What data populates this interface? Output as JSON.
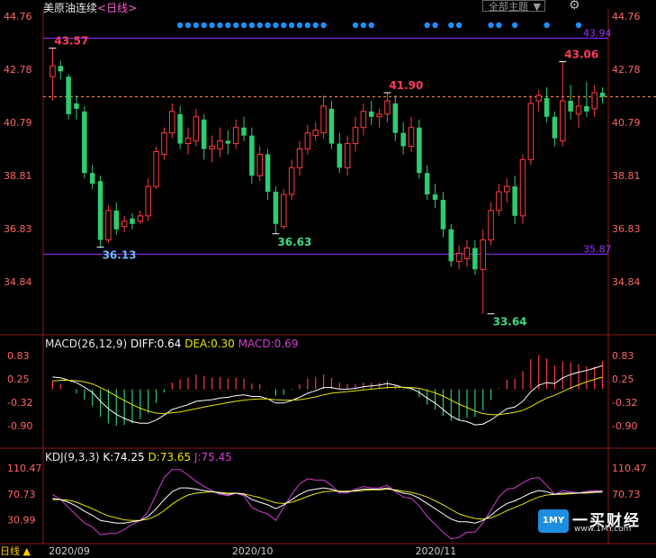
{
  "header": {
    "title": "美原油连续",
    "period_tag": "<日线>",
    "theme_label": "全部主题",
    "theme_caret": "▼",
    "settings_icon": "gear-icon"
  },
  "colors": {
    "up": "#ff3b3b",
    "down": "#2ecc71",
    "purple_line": "#9b30ff",
    "dashed": "#ff8c42",
    "diff": "#ffffff",
    "dea": "#e6e600",
    "macd_label": "#d040d0",
    "marker_dot": "#1e90ff"
  },
  "price_axis": {
    "left_labels": [
      "44.76",
      "42.78",
      "40.79",
      "38.81",
      "36.83",
      "34.84"
    ],
    "right_labels": [
      "44.76",
      "42.78",
      "40.79",
      "38.81",
      "36.83",
      "34.84"
    ]
  },
  "horizontal_lines": {
    "upper": {
      "value": 43.94,
      "label": "43.94"
    },
    "lower": {
      "value": 35.87,
      "label": "35.87"
    },
    "last_price": {
      "value": 41.75
    }
  },
  "annotations": [
    {
      "label": "43.57",
      "value": 43.57,
      "index": 0,
      "kind": "high"
    },
    {
      "label": "36.13",
      "value": 36.13,
      "index": 6,
      "kind": "low"
    },
    {
      "label": "36.63",
      "value": 36.63,
      "index": 28,
      "kind": "low"
    },
    {
      "label": "41.90",
      "value": 41.9,
      "index": 42,
      "kind": "high"
    },
    {
      "label": "33.64",
      "value": 33.64,
      "index": 55,
      "kind": "low"
    },
    {
      "label": "43.06",
      "value": 43.06,
      "index": 64,
      "kind": "high"
    }
  ],
  "x_axis_labels": [
    {
      "label": "2020/09",
      "index": 2
    },
    {
      "label": "2020/10",
      "index": 25
    },
    {
      "label": "2020/11",
      "index": 48
    }
  ],
  "marker_dots": [
    16,
    17,
    18,
    19,
    20,
    21,
    22,
    23,
    24,
    25,
    26,
    27,
    28,
    29,
    30,
    31,
    32,
    33,
    34,
    38,
    39,
    40,
    47,
    48,
    50,
    51,
    55,
    56,
    58,
    62,
    66
  ],
  "macd": {
    "label": "MACD(26,12,9)",
    "diff_label": "DIFF:0.64",
    "dea_label": "DEA:0.30",
    "macd_label": "MACD:0.69",
    "axis_left": [
      "0.83",
      "0.25",
      "-0.32",
      "-0.90"
    ],
    "axis_right": [
      "0.83",
      "0.25",
      "-0.32",
      "-0.90"
    ]
  },
  "kdj": {
    "label": "KDJ(9,3,3)",
    "k_label": "K:74.25",
    "d_label": "D:73.65",
    "j_label": "J:75.45",
    "axis_left": [
      "110.47",
      "70.73",
      "30.99"
    ],
    "axis_right": [
      "110.47",
      "70.73"
    ]
  },
  "bottom_tab": "日线 ▲",
  "logo": {
    "badge": "1MY",
    "name": "一买财经",
    "url": "www.1MY.com"
  },
  "chart_data": {
    "type": "candlestick",
    "candles": [
      [
        42.5,
        42.9,
        43.57,
        41.6
      ],
      [
        42.9,
        42.7,
        43.1,
        42.4
      ],
      [
        42.5,
        41.1,
        42.6,
        40.9
      ],
      [
        41.5,
        41.3,
        41.8,
        40.9
      ],
      [
        41.2,
        38.9,
        41.4,
        38.7
      ],
      [
        38.9,
        38.5,
        39.2,
        38.3
      ],
      [
        38.6,
        36.4,
        38.8,
        36.13
      ],
      [
        36.4,
        37.5,
        37.7,
        36.3
      ],
      [
        37.5,
        36.8,
        37.8,
        36.6
      ],
      [
        36.9,
        37.1,
        37.3,
        36.7
      ],
      [
        37.2,
        37.0,
        37.4,
        36.8
      ],
      [
        37.1,
        37.3,
        37.5,
        37.0
      ],
      [
        37.3,
        38.4,
        38.7,
        37.1
      ],
      [
        38.4,
        39.7,
        39.9,
        38.3
      ],
      [
        39.6,
        40.4,
        40.6,
        39.4
      ],
      [
        40.4,
        41.2,
        41.5,
        40.2
      ],
      [
        41.1,
        40.0,
        41.4,
        39.8
      ],
      [
        40.0,
        40.2,
        40.6,
        39.6
      ],
      [
        40.1,
        41.0,
        41.3,
        39.9
      ],
      [
        40.9,
        39.8,
        41.1,
        39.4
      ],
      [
        39.8,
        39.9,
        40.3,
        39.3
      ],
      [
        39.8,
        40.1,
        40.6,
        39.5
      ],
      [
        40.1,
        40.0,
        40.5,
        39.6
      ],
      [
        40.0,
        40.6,
        40.9,
        39.8
      ],
      [
        40.6,
        40.3,
        41.0,
        40.1
      ],
      [
        40.3,
        38.8,
        40.6,
        38.5
      ],
      [
        38.8,
        39.6,
        39.9,
        38.6
      ],
      [
        39.6,
        38.2,
        39.8,
        37.9
      ],
      [
        38.2,
        37.0,
        38.4,
        36.63
      ],
      [
        36.9,
        38.1,
        38.3,
        36.8
      ],
      [
        38.1,
        39.1,
        39.4,
        37.9
      ],
      [
        39.1,
        39.8,
        40.1,
        38.8
      ],
      [
        39.8,
        40.4,
        40.7,
        39.6
      ],
      [
        40.3,
        40.5,
        40.8,
        40.1
      ],
      [
        40.4,
        41.4,
        41.8,
        40.2
      ],
      [
        41.3,
        40.0,
        41.6,
        39.8
      ],
      [
        40.0,
        39.1,
        40.4,
        38.9
      ],
      [
        39.1,
        40.0,
        40.3,
        38.8
      ],
      [
        40.0,
        40.6,
        41.0,
        39.7
      ],
      [
        40.6,
        41.2,
        41.5,
        40.3
      ],
      [
        41.2,
        41.0,
        41.6,
        40.7
      ],
      [
        41.0,
        41.1,
        41.3,
        40.6
      ],
      [
        41.1,
        41.6,
        41.9,
        40.8
      ],
      [
        41.5,
        40.4,
        41.8,
        40.1
      ],
      [
        40.4,
        39.9,
        40.8,
        39.6
      ],
      [
        39.9,
        40.6,
        41.0,
        39.7
      ],
      [
        40.6,
        38.9,
        40.9,
        38.7
      ],
      [
        38.9,
        38.1,
        39.2,
        37.9
      ],
      [
        38.1,
        37.9,
        38.5,
        37.6
      ],
      [
        37.9,
        36.8,
        38.2,
        36.5
      ],
      [
        36.8,
        35.6,
        37.0,
        35.4
      ],
      [
        35.6,
        35.9,
        36.2,
        35.3
      ],
      [
        35.7,
        36.1,
        36.4,
        35.4
      ],
      [
        36.1,
        35.3,
        36.4,
        35.1
      ],
      [
        35.3,
        36.4,
        36.8,
        33.64
      ],
      [
        36.4,
        37.5,
        37.8,
        36.2
      ],
      [
        37.5,
        38.2,
        38.5,
        37.3
      ],
      [
        38.2,
        38.4,
        38.7,
        37.8
      ],
      [
        38.4,
        37.3,
        38.8,
        37.0
      ],
      [
        37.3,
        39.4,
        39.6,
        37.0
      ],
      [
        39.4,
        41.5,
        41.8,
        39.2
      ],
      [
        41.6,
        41.8,
        42.0,
        41.2
      ],
      [
        41.7,
        41.0,
        42.1,
        40.8
      ],
      [
        41.0,
        40.2,
        41.2,
        39.9
      ],
      [
        40.1,
        41.6,
        43.06,
        39.9
      ],
      [
        41.6,
        41.2,
        42.2,
        40.9
      ],
      [
        41.1,
        41.4,
        41.8,
        40.6
      ],
      [
        41.4,
        41.2,
        42.3,
        41.0
      ],
      [
        41.3,
        41.9,
        42.2,
        41.0
      ],
      [
        41.9,
        41.75,
        42.1,
        41.5
      ]
    ],
    "macd_diff": [
      0.3,
      0.28,
      0.22,
      0.16,
      0.05,
      -0.08,
      -0.3,
      -0.48,
      -0.62,
      -0.72,
      -0.8,
      -0.84,
      -0.84,
      -0.76,
      -0.64,
      -0.5,
      -0.44,
      -0.38,
      -0.3,
      -0.28,
      -0.26,
      -0.22,
      -0.2,
      -0.16,
      -0.14,
      -0.18,
      -0.18,
      -0.24,
      -0.34,
      -0.34,
      -0.28,
      -0.2,
      -0.1,
      -0.04,
      0.04,
      0.04,
      0.0,
      0.0,
      0.02,
      0.06,
      0.08,
      0.1,
      0.14,
      0.1,
      0.04,
      0.02,
      -0.08,
      -0.22,
      -0.34,
      -0.5,
      -0.66,
      -0.76,
      -0.8,
      -0.88,
      -0.86,
      -0.76,
      -0.62,
      -0.48,
      -0.44,
      -0.3,
      -0.06,
      0.1,
      0.16,
      0.14,
      0.28,
      0.36,
      0.42,
      0.46,
      0.52,
      0.58
    ],
    "macd_dea": [
      0.2,
      0.22,
      0.22,
      0.21,
      0.18,
      0.13,
      0.04,
      -0.06,
      -0.17,
      -0.28,
      -0.38,
      -0.47,
      -0.54,
      -0.59,
      -0.6,
      -0.58,
      -0.56,
      -0.52,
      -0.48,
      -0.44,
      -0.4,
      -0.37,
      -0.33,
      -0.3,
      -0.27,
      -0.25,
      -0.24,
      -0.24,
      -0.26,
      -0.27,
      -0.27,
      -0.26,
      -0.23,
      -0.19,
      -0.14,
      -0.1,
      -0.08,
      -0.06,
      -0.04,
      -0.02,
      0.0,
      0.02,
      0.04,
      0.05,
      0.05,
      0.04,
      0.02,
      -0.03,
      -0.09,
      -0.17,
      -0.27,
      -0.37,
      -0.45,
      -0.54,
      -0.6,
      -0.63,
      -0.63,
      -0.6,
      -0.57,
      -0.52,
      -0.43,
      -0.32,
      -0.22,
      -0.15,
      -0.06,
      0.03,
      0.11,
      0.18,
      0.24,
      0.3
    ],
    "macd_hist": [
      0.2,
      0.12,
      0.0,
      -0.1,
      -0.26,
      -0.42,
      -0.68,
      -0.84,
      -0.9,
      -0.88,
      -0.84,
      -0.74,
      -0.6,
      -0.34,
      -0.08,
      0.16,
      0.24,
      0.28,
      0.36,
      0.32,
      0.28,
      0.3,
      0.26,
      0.28,
      0.26,
      0.14,
      0.12,
      0.0,
      -0.16,
      -0.14,
      -0.02,
      0.12,
      0.26,
      0.3,
      0.36,
      0.28,
      0.16,
      0.12,
      0.12,
      0.16,
      0.16,
      0.16,
      0.2,
      0.1,
      -0.02,
      -0.04,
      -0.2,
      -0.38,
      -0.5,
      -0.66,
      -0.78,
      -0.78,
      -0.7,
      -0.68,
      -0.52,
      -0.26,
      0.02,
      0.24,
      0.26,
      0.44,
      0.74,
      0.84,
      0.76,
      0.58,
      0.68,
      0.66,
      0.62,
      0.56,
      0.56,
      0.69
    ],
    "kdj_k": [
      64,
      62,
      58,
      52,
      44,
      38,
      30,
      28,
      26,
      26,
      28,
      30,
      36,
      48,
      62,
      74,
      80,
      80,
      78,
      76,
      74,
      72,
      70,
      72,
      70,
      62,
      58,
      54,
      48,
      54,
      62,
      70,
      76,
      78,
      80,
      78,
      74,
      74,
      76,
      78,
      78,
      78,
      80,
      76,
      72,
      70,
      64,
      56,
      48,
      40,
      32,
      28,
      28,
      26,
      30,
      38,
      48,
      56,
      60,
      66,
      72,
      76,
      74,
      70,
      72,
      72,
      72,
      73,
      74,
      74.25
    ],
    "kdj_d": [
      62,
      62,
      61,
      58,
      53,
      48,
      42,
      37,
      34,
      31,
      30,
      30,
      32,
      37,
      45,
      55,
      63,
      69,
      72,
      73,
      74,
      73,
      72,
      72,
      71,
      68,
      65,
      61,
      57,
      56,
      58,
      62,
      67,
      71,
      74,
      75,
      75,
      75,
      75,
      76,
      77,
      77,
      78,
      77,
      75,
      73,
      70,
      66,
      60,
      54,
      47,
      40,
      36,
      33,
      32,
      34,
      39,
      45,
      50,
      55,
      61,
      66,
      69,
      70,
      70,
      71,
      72,
      72,
      73,
      73.65
    ],
    "kdj_j": [
      70,
      62,
      50,
      38,
      26,
      20,
      8,
      10,
      10,
      16,
      24,
      30,
      44,
      70,
      96,
      108,
      108,
      100,
      90,
      82,
      76,
      70,
      68,
      72,
      68,
      50,
      44,
      40,
      30,
      50,
      70,
      86,
      94,
      92,
      92,
      84,
      72,
      72,
      78,
      82,
      80,
      80,
      84,
      74,
      66,
      64,
      52,
      36,
      24,
      12,
      2,
      4,
      12,
      12,
      26,
      46,
      66,
      78,
      80,
      88,
      94,
      96,
      84,
      70,
      76,
      74,
      72,
      75,
      76,
      75.45
    ]
  }
}
